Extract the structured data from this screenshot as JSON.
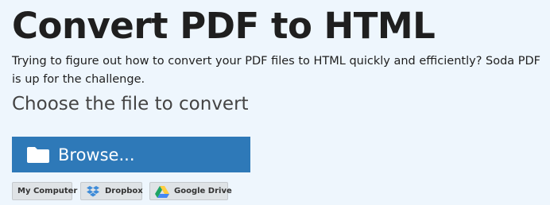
{
  "header": {
    "title": "Convert PDF to HTML",
    "description": "Trying to figure out how to convert your PDF files to HTML quickly and efficiently? Soda PDF is up for the challenge."
  },
  "upload": {
    "choose_label": "Choose the file to convert",
    "browse_label": "Browse...",
    "browse_icon": "folder-icon",
    "sources": [
      {
        "label": "My Computer",
        "icon": ""
      },
      {
        "label": "Dropbox",
        "icon": "dropbox-icon"
      },
      {
        "label": "Google Drive",
        "icon": "google-drive-icon"
      }
    ]
  },
  "colors": {
    "background": "#eef6fd",
    "browse_button": "#2e79b8",
    "source_button": "#dfe3e6",
    "dropbox_blue": "#3d8bd8",
    "drive_green": "#1fa463",
    "drive_yellow": "#ffcd40",
    "drive_blue": "#4688f4"
  }
}
